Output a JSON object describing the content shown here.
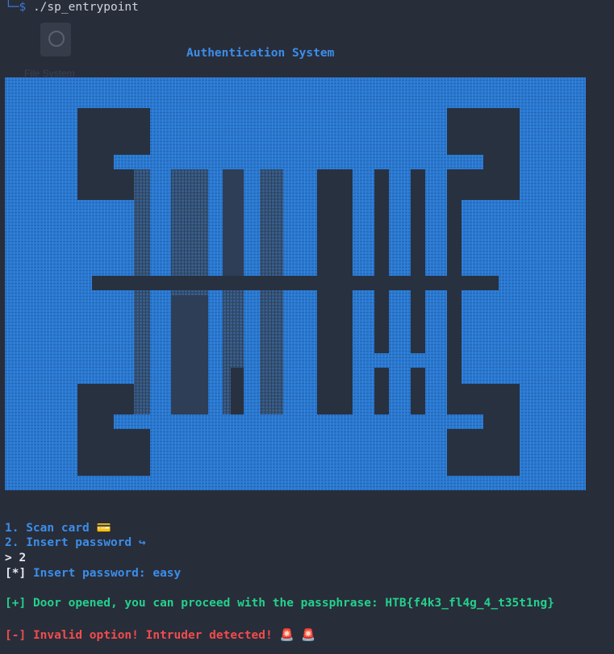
{
  "terminal": {
    "prompt_symbol": "└─$",
    "command": "./sp_entrypoint"
  },
  "desktop": {
    "icon": "disk-icon",
    "icon_label": "File System"
  },
  "banner": {
    "title": "Authentication System"
  },
  "menu": {
    "option1": "1. Scan card",
    "option1_icon": "💳",
    "option2": "2. Insert password",
    "option2_icon": "↪"
  },
  "session": {
    "input_prefix": "> ",
    "input_value": "2",
    "insert_prefix": "[*]",
    "insert_text": "Insert password: easy",
    "success_prefix": "[+]",
    "success_text": "Door opened, you can proceed with the passphrase: HTB{f4k3_fl4g_4_t35t1ng}",
    "error_prefix": "[-]",
    "error_text": "Invalid option! Intruder detected!",
    "error_icons": "🚨 🚨"
  },
  "colors": {
    "background": "#282d3a",
    "art_blue": "#2a78d0",
    "art_dark": "#283140",
    "blue_text": "#3b8eea",
    "green_text": "#23d18b",
    "red_text": "#f14c4c"
  }
}
